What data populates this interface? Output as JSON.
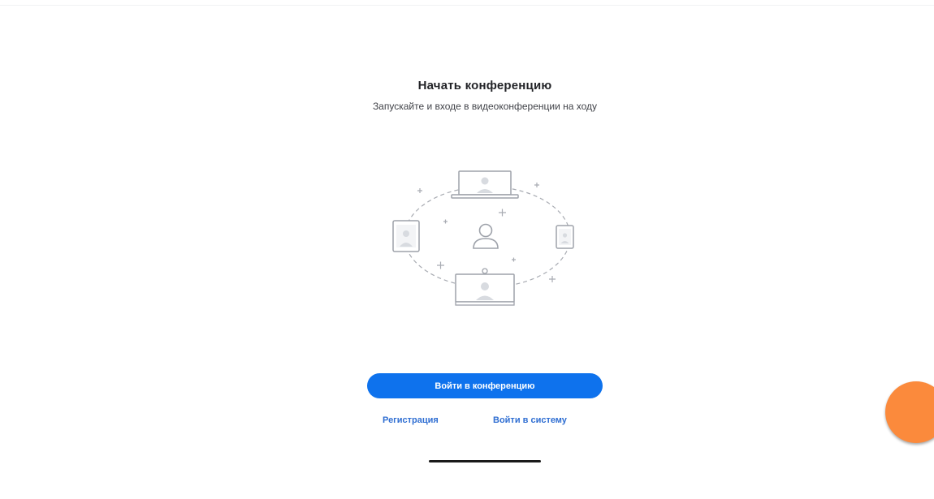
{
  "header": {
    "title": "Начать конференцию",
    "subtitle": "Запускайте и входе в видеоконференции на ходу"
  },
  "illustration": {
    "icon": "video-conference-illustration"
  },
  "actions": {
    "join_label": "Войти в конференцию",
    "signup_label": "Регистрация",
    "signin_label": "Войти в систему"
  },
  "colors": {
    "primary": "#0e72ed",
    "link": "#2f6ed2",
    "accent_circle": "#fb8a3c"
  }
}
